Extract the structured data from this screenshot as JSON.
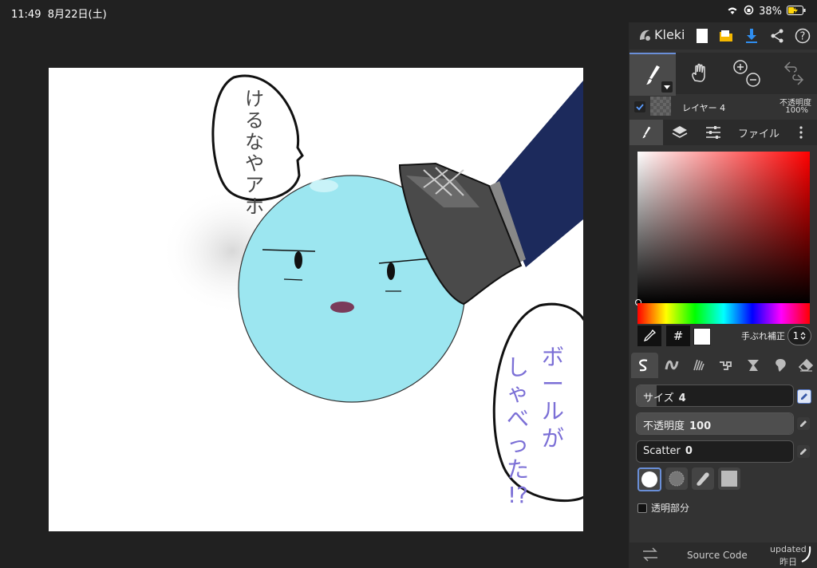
{
  "status": {
    "time": "11:49",
    "date": "8月22日(土)",
    "battery": "38%"
  },
  "app": {
    "name": "Kleki"
  },
  "layer": {
    "name": "レイヤー 4",
    "opacity_label": "不透明度",
    "opacity_value": "100%",
    "checked": true
  },
  "tabs": {
    "file_label": "ファイル"
  },
  "color": {
    "hash": "#",
    "stabilizer_label": "手ぶれ補正",
    "stabilizer_value": "1",
    "current": "#ffffff"
  },
  "sliders": [
    {
      "label": "サイズ",
      "value": "4",
      "fraction": 0.13
    },
    {
      "label": "不透明度",
      "value": "100",
      "fraction": 1.0
    },
    {
      "label": "Scatter",
      "value": "0",
      "fraction": 0.0
    }
  ],
  "transparent_label": "透明部分",
  "footer": {
    "source_label": "Source Code",
    "updated_label": "updated",
    "updated_when": "昨日"
  },
  "drawing": {
    "bubble_left_text": [
      "け",
      "る",
      "な",
      "や",
      "ア",
      "ホ"
    ],
    "bubble_right_text": [
      "ボ",
      "ー",
      "ル",
      "が",
      "し",
      "ゃ",
      "べ",
      "っ",
      "た",
      "!?"
    ]
  },
  "colors": {
    "ball": "#9ce6f0",
    "pants": "#1c2a5c",
    "shoe": "#4a4a4a",
    "accent": "#6a8fd8",
    "text_purple": "#7b6fd6"
  }
}
